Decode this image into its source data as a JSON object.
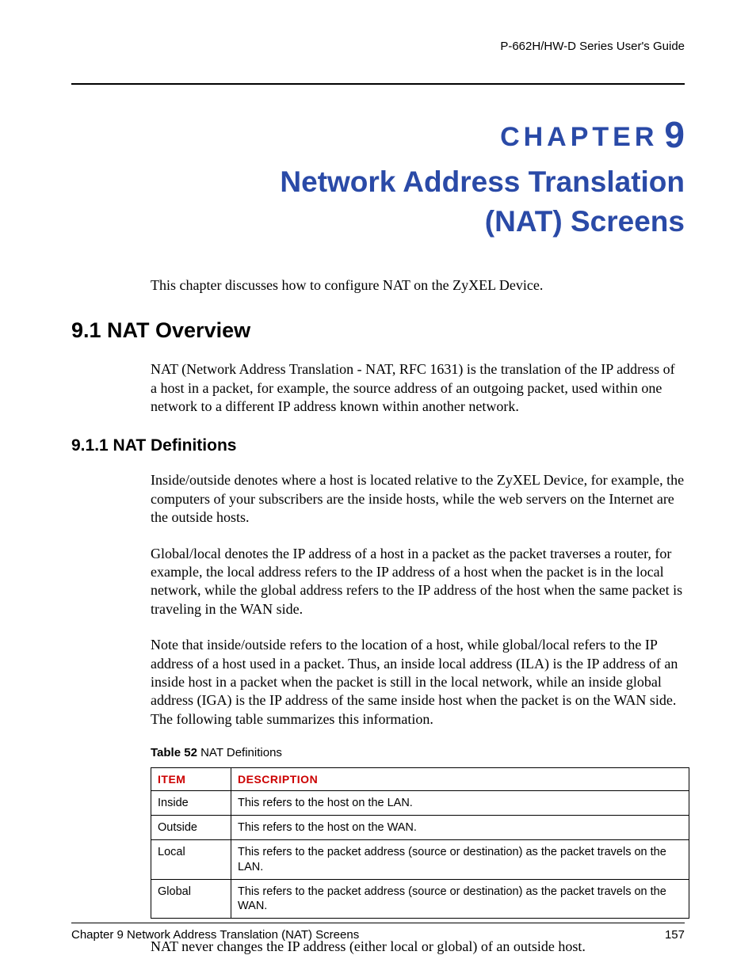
{
  "header": {
    "guide": "P-662H/HW-D Series User's Guide"
  },
  "chapter": {
    "label_prefix": "CHAPTER",
    "label_number": "9",
    "title_line1": "Network Address Translation",
    "title_line2": "(NAT) Screens"
  },
  "intro": "This chapter discusses how to configure NAT on the ZyXEL Device.",
  "section_9_1": {
    "heading": "9.1  NAT Overview",
    "para": "NAT (Network Address Translation - NAT, RFC 1631) is the translation of the IP address of a host in a packet, for example, the source address of an outgoing packet, used within one network to a different IP address known within another network."
  },
  "section_9_1_1": {
    "heading": "9.1.1  NAT Definitions",
    "para1": "Inside/outside denotes where a host is located relative to the ZyXEL Device, for example, the computers of your subscribers are the inside hosts, while the web servers on the Internet are the outside hosts.",
    "para2": "Global/local denotes the IP address of a host in a packet as the packet traverses a router, for example, the local address refers to the IP address of a host when the packet is in the local network, while the global address refers to the IP address of the host when the same packet is traveling in the WAN side.",
    "para3": "Note that inside/outside refers to the location of a host, while global/local refers to the IP address of a host used in a packet.  Thus, an inside local address (ILA) is the IP address of an inside host in a packet when the packet is still in the local network, while an inside global address (IGA) is the IP address of the same inside host when the packet is on the WAN side. The following table summarizes this information."
  },
  "table": {
    "caption_bold": "Table 52",
    "caption_rest": "   NAT Definitions",
    "head_item": "ITEM",
    "head_desc": "DESCRIPTION",
    "rows": [
      {
        "item": "Inside",
        "desc": "This refers to the host on the LAN."
      },
      {
        "item": "Outside",
        "desc": "This refers to the host on the WAN."
      },
      {
        "item": "Local",
        "desc": "This refers to the packet address (source or destination) as the packet travels on the LAN."
      },
      {
        "item": "Global",
        "desc": "This refers to the packet address (source or destination) as the packet travels on the WAN."
      }
    ]
  },
  "closing_para": "NAT never changes the IP address (either local or global) of an outside host.",
  "footer": {
    "left": "Chapter 9 Network Address Translation (NAT) Screens",
    "right": "157"
  }
}
